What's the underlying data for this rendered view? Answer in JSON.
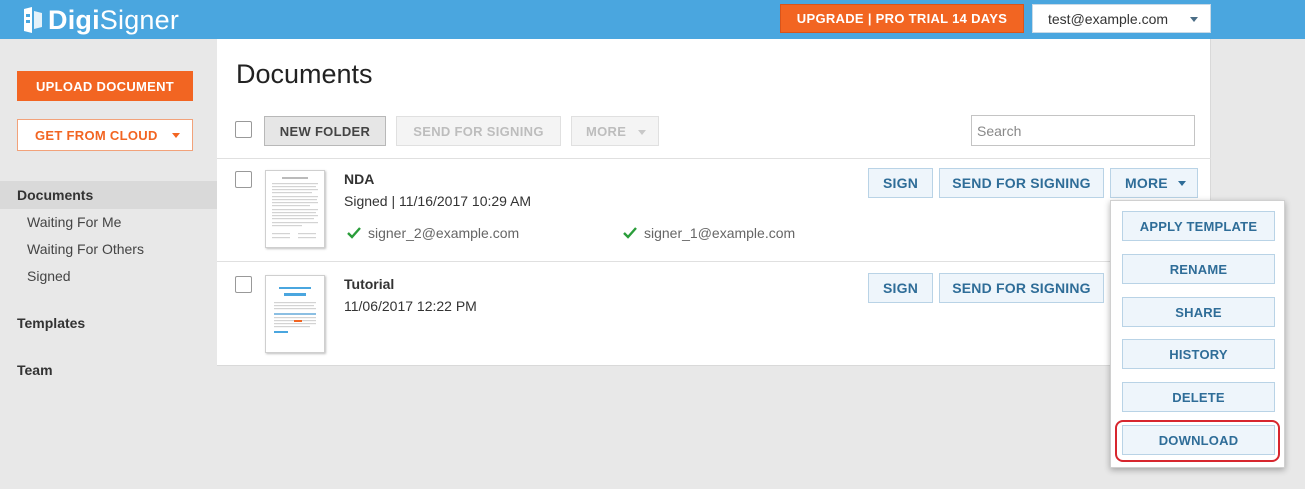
{
  "brand": {
    "name_bold": "Digi",
    "name_light": "Signer"
  },
  "header": {
    "upgrade_label": "UPGRADE | PRO TRIAL 14 DAYS",
    "user_email": "test@example.com"
  },
  "sidebar": {
    "upload_label": "UPLOAD DOCUMENT",
    "cloud_label": "GET FROM CLOUD",
    "documents_label": "Documents",
    "sub_items": [
      "Waiting For Me",
      "Waiting For Others",
      "Signed"
    ],
    "templates_label": "Templates",
    "team_label": "Team"
  },
  "main": {
    "title": "Documents",
    "toolbar": {
      "new_folder_label": "NEW FOLDER",
      "send_label": "SEND FOR SIGNING",
      "more_label": "MORE",
      "search_placeholder": "Search"
    },
    "documents": [
      {
        "name": "NDA",
        "meta": "Signed | 11/16/2017 10:29 AM",
        "signers": [
          "signer_2@example.com",
          "signer_1@example.com"
        ],
        "sign_label": "SIGN",
        "send_label": "SEND FOR SIGNING",
        "more_label": "MORE"
      },
      {
        "name": "Tutorial",
        "meta": "11/06/2017 12:22 PM",
        "sign_label": "SIGN",
        "send_label": "SEND FOR SIGNING"
      }
    ]
  },
  "more_menu": [
    "APPLY TEMPLATE",
    "RENAME",
    "SHARE",
    "HISTORY",
    "DELETE",
    "DOWNLOAD"
  ],
  "colors": {
    "brand_blue": "#4aa6df",
    "accent_orange": "#f26522",
    "button_text": "#2f6d98",
    "highlight_red": "#d7262e"
  }
}
